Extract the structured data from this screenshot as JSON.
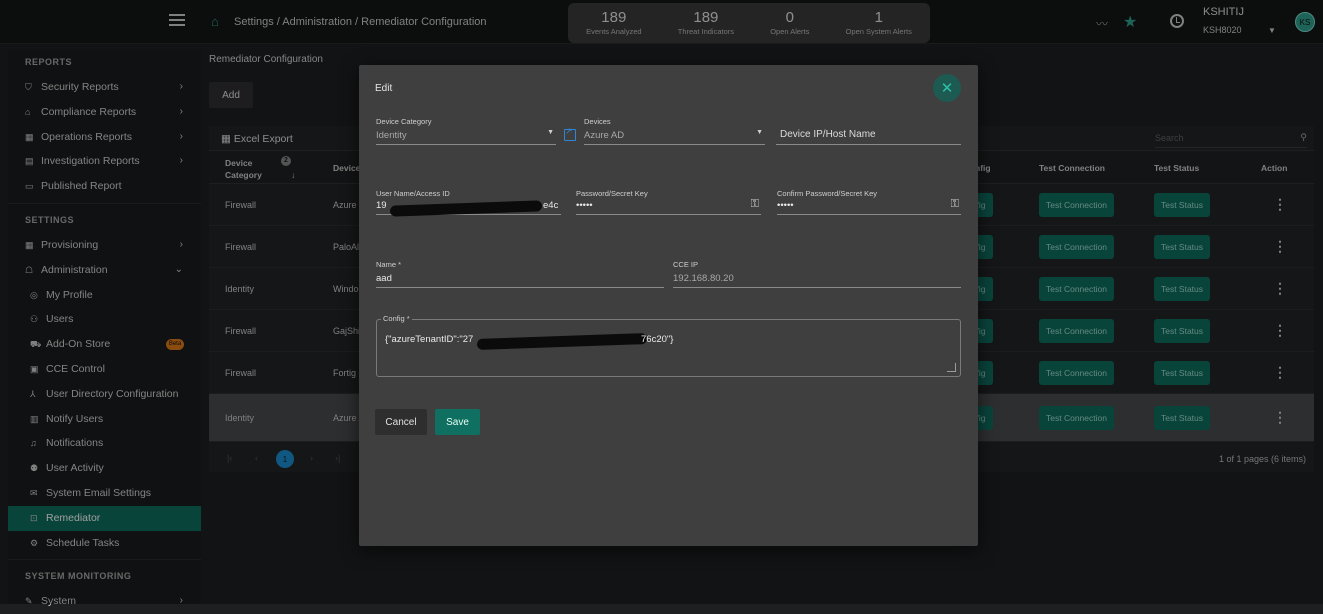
{
  "header": {
    "breadcrumb": "Settings / Administration / Remediator Configuration",
    "stats": [
      {
        "value": "189",
        "label": "Events Analyzed"
      },
      {
        "value": "189",
        "label": "Threat Indicators"
      },
      {
        "value": "0",
        "label": "Open Alerts"
      },
      {
        "value": "1",
        "label": "Open System Alerts"
      }
    ],
    "user": {
      "name": "KSHITIJ",
      "tenant": "KSH8020",
      "initials": "KS"
    },
    "icons": [
      "menu-icon",
      "home-icon",
      "trend-icon",
      "star-icon",
      "clock-icon"
    ]
  },
  "sidebar": {
    "sections": {
      "reports": "REPORTS",
      "settings": "SETTINGS",
      "monitoring": "SYSTEM MONITORING"
    },
    "reports": [
      {
        "label": "Security Reports",
        "icon": "shield-icon"
      },
      {
        "label": "Compliance Reports",
        "icon": "bank-icon"
      },
      {
        "label": "Operations Reports",
        "icon": "grid-icon"
      },
      {
        "label": "Investigation Reports",
        "icon": "list-icon"
      },
      {
        "label": "Published Report",
        "icon": "monitor-icon"
      }
    ],
    "settings": [
      {
        "label": "Provisioning",
        "icon": "grid-icon"
      },
      {
        "label": "Administration",
        "icon": "admin-icon"
      }
    ],
    "admin_items": [
      {
        "label": "My Profile",
        "icon": "profile-icon"
      },
      {
        "label": "Users",
        "icon": "users-icon"
      },
      {
        "label": "Add-On Store",
        "icon": "cart-icon",
        "badge": "Beta"
      },
      {
        "label": "CCE Control",
        "icon": "control-icon"
      },
      {
        "label": "User Directory Configuration",
        "icon": "directory-icon"
      },
      {
        "label": "Notify Users",
        "icon": "notify-icon"
      },
      {
        "label": "Notifications",
        "icon": "bell-icon"
      },
      {
        "label": "User Activity",
        "icon": "activity-icon"
      },
      {
        "label": "System Email Settings",
        "icon": "email-icon"
      },
      {
        "label": "Remediator",
        "icon": "remediator-icon",
        "active": true
      },
      {
        "label": "Schedule Tasks",
        "icon": "schedule-icon"
      }
    ],
    "monitoring": [
      {
        "label": "System",
        "icon": "wrench-icon"
      }
    ]
  },
  "main": {
    "title": "Remediator Configuration",
    "add_label": "Add",
    "excel_label": "Excel Export",
    "search_placeholder": "Search",
    "columns": {
      "device_category": "Device Category",
      "device": "Devices",
      "sort_badge": "2",
      "config": "nfig",
      "test_connection": "Test Connection",
      "test_status": "Test Status",
      "action": "Action"
    },
    "rows": [
      {
        "category": "Firewall",
        "device": "Azure I",
        "config": "fig",
        "tc": "Test Connection",
        "ts": "Test Status"
      },
      {
        "category": "Firewall",
        "device": "PaloAl",
        "config": "fig",
        "tc": "Test Connection",
        "ts": "Test Status"
      },
      {
        "category": "Identity",
        "device": "Windo",
        "config": "fig",
        "tc": "Test Connection",
        "ts": "Test Status"
      },
      {
        "category": "Firewall",
        "device": "GajShi",
        "config": "fig",
        "tc": "Test Connection",
        "ts": "Test Status"
      },
      {
        "category": "Firewall",
        "device": "Fortig",
        "config": "fig",
        "tc": "Test Connection",
        "ts": "Test Status"
      },
      {
        "category": "Identity",
        "device": "Azure A",
        "config": "fig",
        "tc": "Test Connection",
        "ts": "Test Status"
      }
    ],
    "pager": {
      "current": "1",
      "info": "1 of 1 pages (6 items)"
    }
  },
  "modal": {
    "title": "Edit",
    "close_glyph": "✕",
    "device_category": {
      "label": "Device Category",
      "value": "Identity"
    },
    "devices": {
      "label": "Devices",
      "value": "Azure AD"
    },
    "device_ip": {
      "placeholder": "Device IP/Host Name"
    },
    "username": {
      "label": "User Name/Access ID",
      "value_start": "19",
      "value_end": "e4c"
    },
    "password": {
      "label": "Password/Secret Key",
      "value": "•••••"
    },
    "confirm_password": {
      "label": "Confirm Password/Secret Key",
      "value": "•••••"
    },
    "name": {
      "label": "Name *",
      "value": "aad"
    },
    "cce_ip": {
      "label": "CCE IP",
      "value": "192.168.80.20"
    },
    "config": {
      "label": "Config *",
      "value_start": "{\"azureTenantID\":\"27",
      "value_end": "76c20\"}"
    },
    "cancel_label": "Cancel",
    "save_label": "Save"
  }
}
